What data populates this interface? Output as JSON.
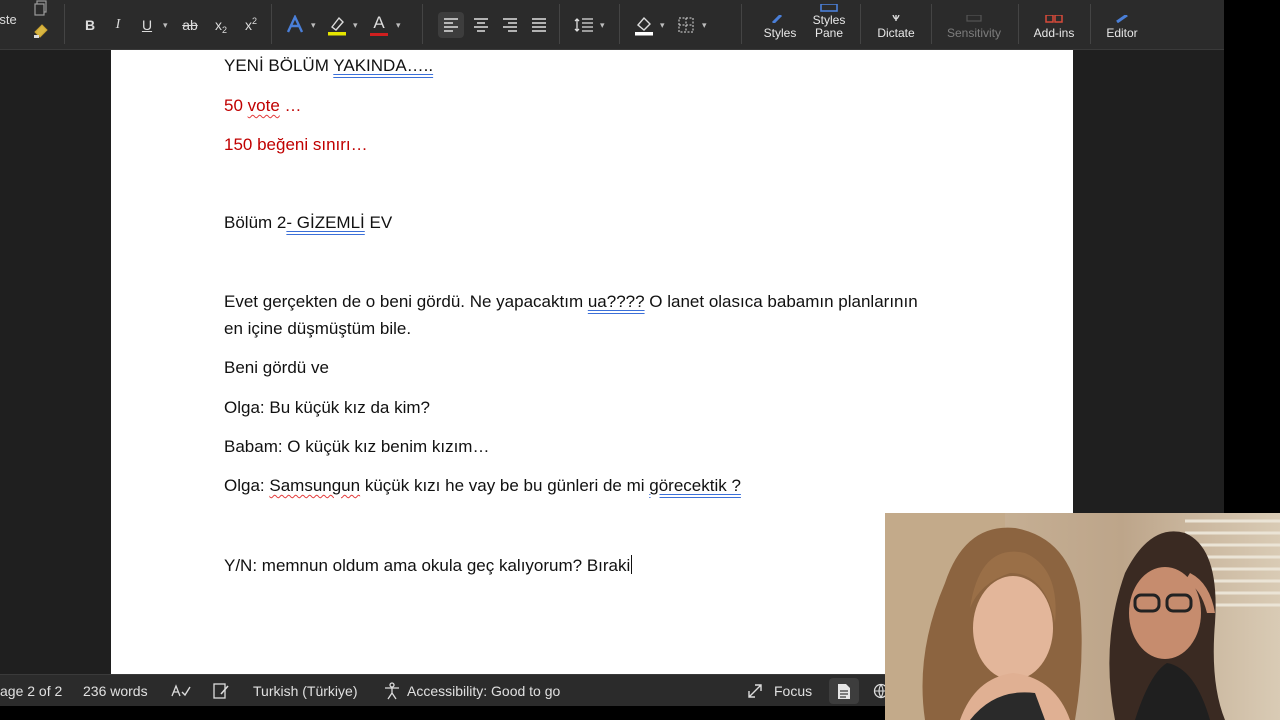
{
  "ribbon": {
    "paste_label": "ste",
    "bold": "B",
    "italic": "I",
    "underline": "U",
    "strike": "ab",
    "subscript": "x",
    "subscript_mark": "2",
    "superscript": "x",
    "superscript_mark": "2",
    "font_color_letter": "A",
    "styles": "Styles",
    "styles_pane": "Styles Pane",
    "dictate": "Dictate",
    "sensitivity": "Sensitivity",
    "addins": "Add-ins",
    "editor": "Editor"
  },
  "document": {
    "p1_a": "YENİ BÖLÜM ",
    "p1_b": "YAKINDA…..",
    "p2_a": "50 ",
    "p2_b": "vote",
    "p2_c": " …",
    "p3": "150 beğeni sınırı…",
    "p4_a": "Bölüm 2",
    "p4_b": "-  GİZEMLİ",
    "p4_c": " EV",
    "p5_a": "Evet gerçekten de o beni gördü. Ne yapacaktım ",
    "p5_b": "ua????",
    "p5_c": " O lanet olasıca babamın planlarının",
    "p5_d": "en içine düşmüştüm bile.",
    "p6": "Beni gördü ve",
    "p7": "Olga: Bu küçük kız da kim?",
    "p8": "Babam: O küçük kız benim kızım…",
    "p9_a": "Olga: ",
    "p9_b": "Samsungun",
    "p9_c": " küçük kızı he vay be bu günleri de mi ",
    "p9_d": "görecektik ?",
    "p10": "Y/N: memnun oldum ama okula geç kalıyorum? Bıraki"
  },
  "status": {
    "page": "age 2 of 2",
    "words": "236 words",
    "language": "Turkish (Türkiye)",
    "accessibility": "Accessibility: Good to go",
    "focus": "Focus"
  },
  "colors": {
    "ribbon_bg": "#2b2b2b",
    "page_bg": "#ffffff",
    "red_text": "#c00000",
    "highlight_yellow": "#e6e600",
    "font_color_red": "#d01f1f",
    "font_blue_effect": "#4a7fd8"
  }
}
